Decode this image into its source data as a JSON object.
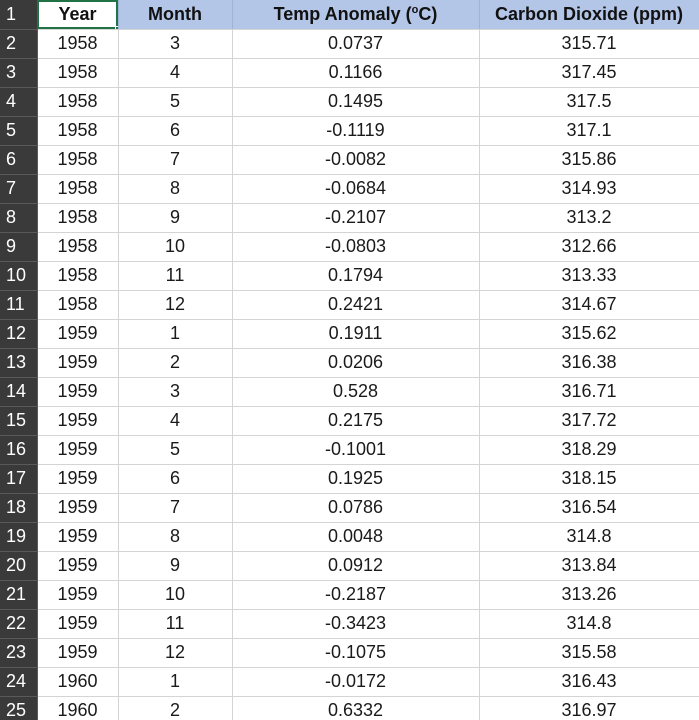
{
  "columns": {
    "year": "Year",
    "month": "Month",
    "temp_prefix": "Temp Anomaly (",
    "temp_sup": "o",
    "temp_suffix": "C)",
    "co2": "Carbon Dioxide (ppm)"
  },
  "header_row_number": "1",
  "active_cell": "Year",
  "rows": [
    {
      "n": "2",
      "year": "1958",
      "month": "3",
      "temp": "0.0737",
      "co2": "315.71"
    },
    {
      "n": "3",
      "year": "1958",
      "month": "4",
      "temp": "0.1166",
      "co2": "317.45"
    },
    {
      "n": "4",
      "year": "1958",
      "month": "5",
      "temp": "0.1495",
      "co2": "317.5"
    },
    {
      "n": "5",
      "year": "1958",
      "month": "6",
      "temp": "-0.1119",
      "co2": "317.1"
    },
    {
      "n": "6",
      "year": "1958",
      "month": "7",
      "temp": "-0.0082",
      "co2": "315.86"
    },
    {
      "n": "7",
      "year": "1958",
      "month": "8",
      "temp": "-0.0684",
      "co2": "314.93"
    },
    {
      "n": "8",
      "year": "1958",
      "month": "9",
      "temp": "-0.2107",
      "co2": "313.2"
    },
    {
      "n": "9",
      "year": "1958",
      "month": "10",
      "temp": "-0.0803",
      "co2": "312.66"
    },
    {
      "n": "10",
      "year": "1958",
      "month": "11",
      "temp": "0.1794",
      "co2": "313.33"
    },
    {
      "n": "11",
      "year": "1958",
      "month": "12",
      "temp": "0.2421",
      "co2": "314.67"
    },
    {
      "n": "12",
      "year": "1959",
      "month": "1",
      "temp": "0.1911",
      "co2": "315.62"
    },
    {
      "n": "13",
      "year": "1959",
      "month": "2",
      "temp": "0.0206",
      "co2": "316.38"
    },
    {
      "n": "14",
      "year": "1959",
      "month": "3",
      "temp": "0.528",
      "co2": "316.71"
    },
    {
      "n": "15",
      "year": "1959",
      "month": "4",
      "temp": "0.2175",
      "co2": "317.72"
    },
    {
      "n": "16",
      "year": "1959",
      "month": "5",
      "temp": "-0.1001",
      "co2": "318.29"
    },
    {
      "n": "17",
      "year": "1959",
      "month": "6",
      "temp": "0.1925",
      "co2": "318.15"
    },
    {
      "n": "18",
      "year": "1959",
      "month": "7",
      "temp": "0.0786",
      "co2": "316.54"
    },
    {
      "n": "19",
      "year": "1959",
      "month": "8",
      "temp": "0.0048",
      "co2": "314.8"
    },
    {
      "n": "20",
      "year": "1959",
      "month": "9",
      "temp": "0.0912",
      "co2": "313.84"
    },
    {
      "n": "21",
      "year": "1959",
      "month": "10",
      "temp": "-0.2187",
      "co2": "313.26"
    },
    {
      "n": "22",
      "year": "1959",
      "month": "11",
      "temp": "-0.3423",
      "co2": "314.8"
    },
    {
      "n": "23",
      "year": "1959",
      "month": "12",
      "temp": "-0.1075",
      "co2": "315.58"
    },
    {
      "n": "24",
      "year": "1960",
      "month": "1",
      "temp": "-0.0172",
      "co2": "316.43"
    },
    {
      "n": "25",
      "year": "1960",
      "month": "2",
      "temp": "0.6332",
      "co2": "316.97"
    }
  ],
  "colors": {
    "header_fill": "#b4c6e7",
    "row_number_fill": "#3a3a3a",
    "selection_accent": "#217346",
    "gridline": "#d4d4d4"
  }
}
